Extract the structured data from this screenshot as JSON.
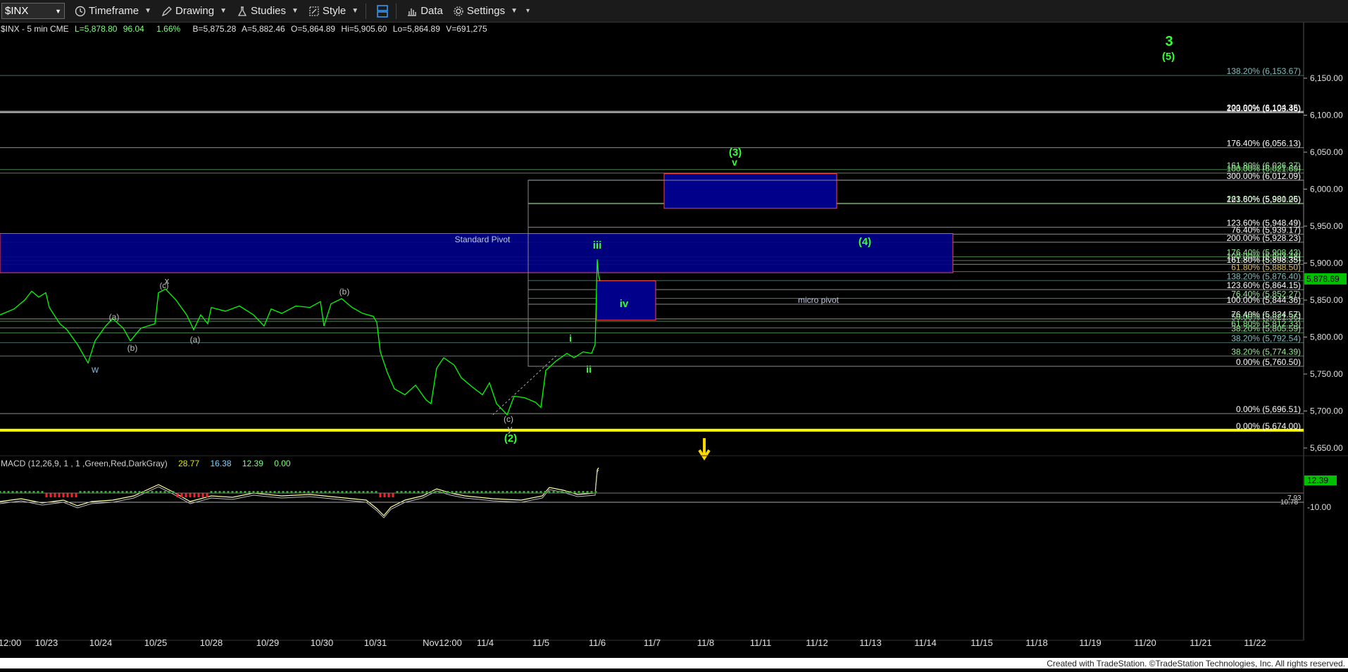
{
  "toolbar": {
    "symbol": "$INX",
    "timeframe": "Timeframe",
    "drawing": "Drawing",
    "studies": "Studies",
    "style": "Style",
    "data": "Data",
    "settings": "Settings"
  },
  "header": {
    "symbol_line": "$INX - 5 min  CME",
    "last": "L=5,878.80",
    "change": "96.04",
    "pct": "1.66%",
    "bid": "B=5,875.28",
    "ask": "A=5,882.46",
    "open": "O=5,864.89",
    "high": "Hi=5,905.60",
    "low": "Lo=5,864.89",
    "volume": "V=691,275"
  },
  "price_axis": {
    "ticks": [
      "6,150.00",
      "6,100.00",
      "6,050.00",
      "6,000.00",
      "5,950.00",
      "5,900.00",
      "5,850.00",
      "5,800.00",
      "5,750.00",
      "5,700.00",
      "5,650.00"
    ],
    "tick_values": [
      6150,
      6100,
      6050,
      6000,
      5950,
      5900,
      5850,
      5800,
      5750,
      5700,
      5650
    ],
    "current_price": "5,878.69",
    "current_value": 5878.69
  },
  "macd": {
    "label": "MACD (12,26,9, 1 , 1 ,Green,Red,DarkGray)",
    "v1": "28.77",
    "v2": "16.38",
    "v3": "12.39",
    "v4": "0.00",
    "axis_value": "12.39",
    "axis_tick": "-10.00",
    "small_a": "7.93",
    "small_b": "10.78"
  },
  "time_axis": {
    "labels": [
      "12:00",
      "10/23",
      "10/24",
      "10/25",
      "10/28",
      "10/29",
      "10/30",
      "10/31",
      "Nov12:00",
      "11/4",
      "11/5",
      "11/6",
      "11/7",
      "11/8",
      "11/11",
      "11/12",
      "11/13",
      "11/14",
      "11/15",
      "11/18",
      "11/19",
      "11/20",
      "11/21",
      "11/22"
    ]
  },
  "footer": "Created with TradeStation. ©TradeStation Technologies, Inc. All rights reserved.",
  "fib_levels": [
    {
      "label": "138.20% (6,153.67)",
      "price": 6153.67,
      "color": "#7fbfbf"
    },
    {
      "label": "200.00% (6,104.35)",
      "price": 6104.35,
      "color": "#ffffff"
    },
    {
      "label": "123.60% (6,103.46)",
      "price": 6103.46,
      "color": "#ffffff"
    },
    {
      "label": "176.40% (6,056.13)",
      "price": 6056.13,
      "color": "#ffffff"
    },
    {
      "label": "161.80% (6,026.37)",
      "price": 6026.37,
      "color": "#90ee90"
    },
    {
      "label": "100.00% (6,021.69)",
      "price": 6021.69,
      "color": "#90ee90"
    },
    {
      "label": "300.00% (6,012.09)",
      "price": 6012.09,
      "color": "#ffffff"
    },
    {
      "label": "261.80% (5,981.05)",
      "price": 5981.05,
      "color": "#90ee90"
    },
    {
      "label": "123.60% (5,980.26)",
      "price": 5980.26,
      "color": "#ffffff"
    },
    {
      "label": "123.60% (5,948.49)",
      "price": 5948.49,
      "color": "#ffffff"
    },
    {
      "label": "76.40% (5,939.17)",
      "price": 5939.17,
      "color": "#ffffff"
    },
    {
      "label": "200.00% (5,928.23)",
      "price": 5928.23,
      "color": "#ffffff"
    },
    {
      "label": "176.40% (5,908.43)",
      "price": 5908.43,
      "color": "#90ee90"
    },
    {
      "label": "100.00% (5,903.48)",
      "price": 5903.48,
      "color": "#90ee90"
    },
    {
      "label": "161.80% (5,898.35)",
      "price": 5898.35,
      "color": "#ffffff"
    },
    {
      "label": "61.80% (5,888.50)",
      "price": 5888.5,
      "color": "#e0c060"
    },
    {
      "label": "138.20% (5,876.40)",
      "price": 5876.4,
      "color": "#7fbfbf"
    },
    {
      "label": "123.60% (5,864.15)",
      "price": 5864.15,
      "color": "#ffffff"
    },
    {
      "label": "76.40% (5,852.27)",
      "price": 5852.27,
      "color": "#90ee90"
    },
    {
      "label": "100.00% (5,844.36)",
      "price": 5844.36,
      "color": "#ffffff"
    },
    {
      "label": "76.40% (5,824.57)",
      "price": 5824.57,
      "color": "#ffffff"
    },
    {
      "label": "50.00% (5,821.36)",
      "price": 5821.36,
      "color": "#90ee90"
    },
    {
      "label": "61.80% (5,812.33)",
      "price": 5812.33,
      "color": "#90ee90"
    },
    {
      "label": "38.20% (5,805.59)",
      "price": 5805.59,
      "color": "#90ee90"
    },
    {
      "label": "38.20% (5,792.54)",
      "price": 5792.54,
      "color": "#7fbfbf"
    },
    {
      "label": "38.20% (5,774.39)",
      "price": 5774.39,
      "color": "#90ee90"
    },
    {
      "label": "0.00% (5,760.50)",
      "price": 5760.5,
      "color": "#ffffff"
    },
    {
      "label": "0.00% (5,696.51)",
      "price": 5696.51,
      "color": "#ffffff"
    },
    {
      "label": "0.00% (5,674.00)",
      "price": 5674.0,
      "color": "#ffffff"
    }
  ],
  "annotations": {
    "standard_pivot": "Standard Pivot",
    "micro_pivot": "micro pivot",
    "wave_3_big": "3",
    "wave_5": "(5)",
    "wave_3_paren": "(3)",
    "wave_v": "v",
    "wave_4": "(4)",
    "wave_iii": "iii",
    "wave_iv": "iv",
    "wave_i": "i",
    "wave_ii": "ii",
    "wave_2": "(2)",
    "wave_y": "y",
    "wave_c": "(c)",
    "wave_w": "w",
    "wave_x": "x",
    "wave_a1": "(a)",
    "wave_b1": "(b)",
    "wave_a2": "(a)",
    "wave_b2": "(b)",
    "wave_c2": "(c)"
  },
  "colors": {
    "zone_fill": "#00008b",
    "zone_border": "#ff4040",
    "price_line": "#00ff00",
    "support_line": "#ffff00",
    "current_badge": "#00c000"
  }
}
